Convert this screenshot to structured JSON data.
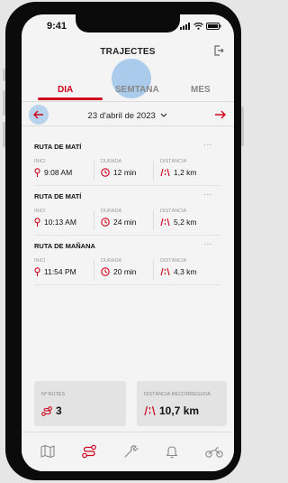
{
  "status_bar": {
    "time": "9:41"
  },
  "header": {
    "title": "TRAJECTES"
  },
  "tabs": [
    {
      "label": "DIA",
      "active": true
    },
    {
      "label": "SEMTANA",
      "active": false
    },
    {
      "label": "MES",
      "active": false
    }
  ],
  "date_bar": {
    "date": "23 d'abril de 2023"
  },
  "routes": [
    {
      "name": "RUTA DE MATÍ",
      "start_label": "INICI",
      "start": "9:08 AM",
      "duration_label": "DURADA",
      "duration": "12 min",
      "distance_label": "DISTÀNCIA",
      "distance": "1,2 km"
    },
    {
      "name": "RUTA DE MATÍ",
      "start_label": "INICI",
      "start": "10:13 AM",
      "duration_label": "DURADA",
      "duration": "24 min",
      "distance_label": "DISTÀNCIA",
      "distance": "5,2 km"
    },
    {
      "name": "RUTA DE MAÑANA",
      "start_label": "INICI",
      "start": "11:54 PM",
      "duration_label": "DURADA",
      "duration": "20 min",
      "distance_label": "DISTÀNCIA",
      "distance": "4,3 km"
    }
  ],
  "more_label": "···",
  "summary": {
    "routes_label": "Nº RUTES",
    "routes_count": "3",
    "distance_label": "DISTÀNCIA RECORREGUDA",
    "distance_total": "10,7 km"
  },
  "colors": {
    "accent": "#d0021b",
    "highlight": "#9ec3ea"
  },
  "nav_icons": [
    "map-icon",
    "route-icon",
    "wrench-icon",
    "bell-icon",
    "motorbike-icon"
  ]
}
